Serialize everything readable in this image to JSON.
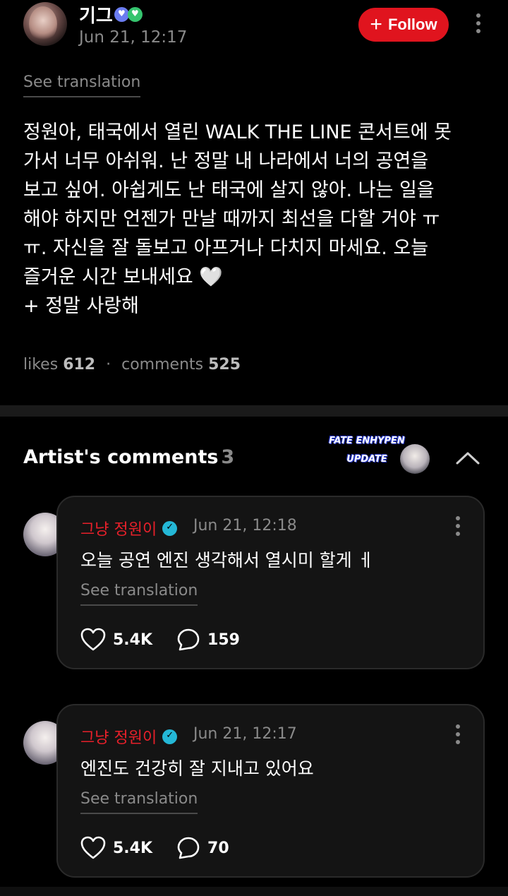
{
  "post": {
    "username": "기그",
    "timestamp": "Jun 21, 12:17",
    "follow_label": "Follow",
    "see_translation": "See translation",
    "body": "정원아, 태국에서 열린 WALK THE LINE 콘서트에 못\n가서 너무 아쉬워. 난 정말 내 나라에서 너의 공연을\n보고 싶어. 아쉽게도 난 태국에 살지 않아. 나는 일을\n해야 하지만 언젠가 만날 때까지 최선을 다할 거야 ㅠ\nㅠ. 자신을 잘 돌보고 아프거나 다치지 마세요. 오늘\n즐거운 시간 보내세요 🤍\n+ 정말 사랑해",
    "likes_label": "likes",
    "likes_count": "612",
    "comments_label": "comments",
    "comments_count": "525"
  },
  "artist_comments": {
    "title": "Artist's comments",
    "count": "3",
    "watermark_line1": "FATE ENHYPEN",
    "watermark_line2": "UPDATE",
    "items": [
      {
        "name": "그냥 정원이",
        "timestamp": "Jun 21, 12:18",
        "text": "오늘 공연 엔진 생각해서 열시미 할게 ㅔ",
        "see_translation": "See translation",
        "likes": "5.4K",
        "replies": "159"
      },
      {
        "name": "그냥 정원이",
        "timestamp": "Jun 21, 12:17",
        "text": "엔진도 건강히 잘 지내고 있어요",
        "see_translation": "See translation",
        "likes": "5.4K",
        "replies": "70"
      }
    ]
  },
  "colors": {
    "accent_red": "#e0141e",
    "artist_name": "#e8202a",
    "verified": "#24b7d6",
    "muted": "#8a8a8a"
  },
  "icons": [
    "heart-badge-icon",
    "more-vertical-icon",
    "plus-icon",
    "verified-icon",
    "heart-icon",
    "comment-bubble-icon",
    "chevron-up-icon"
  ]
}
